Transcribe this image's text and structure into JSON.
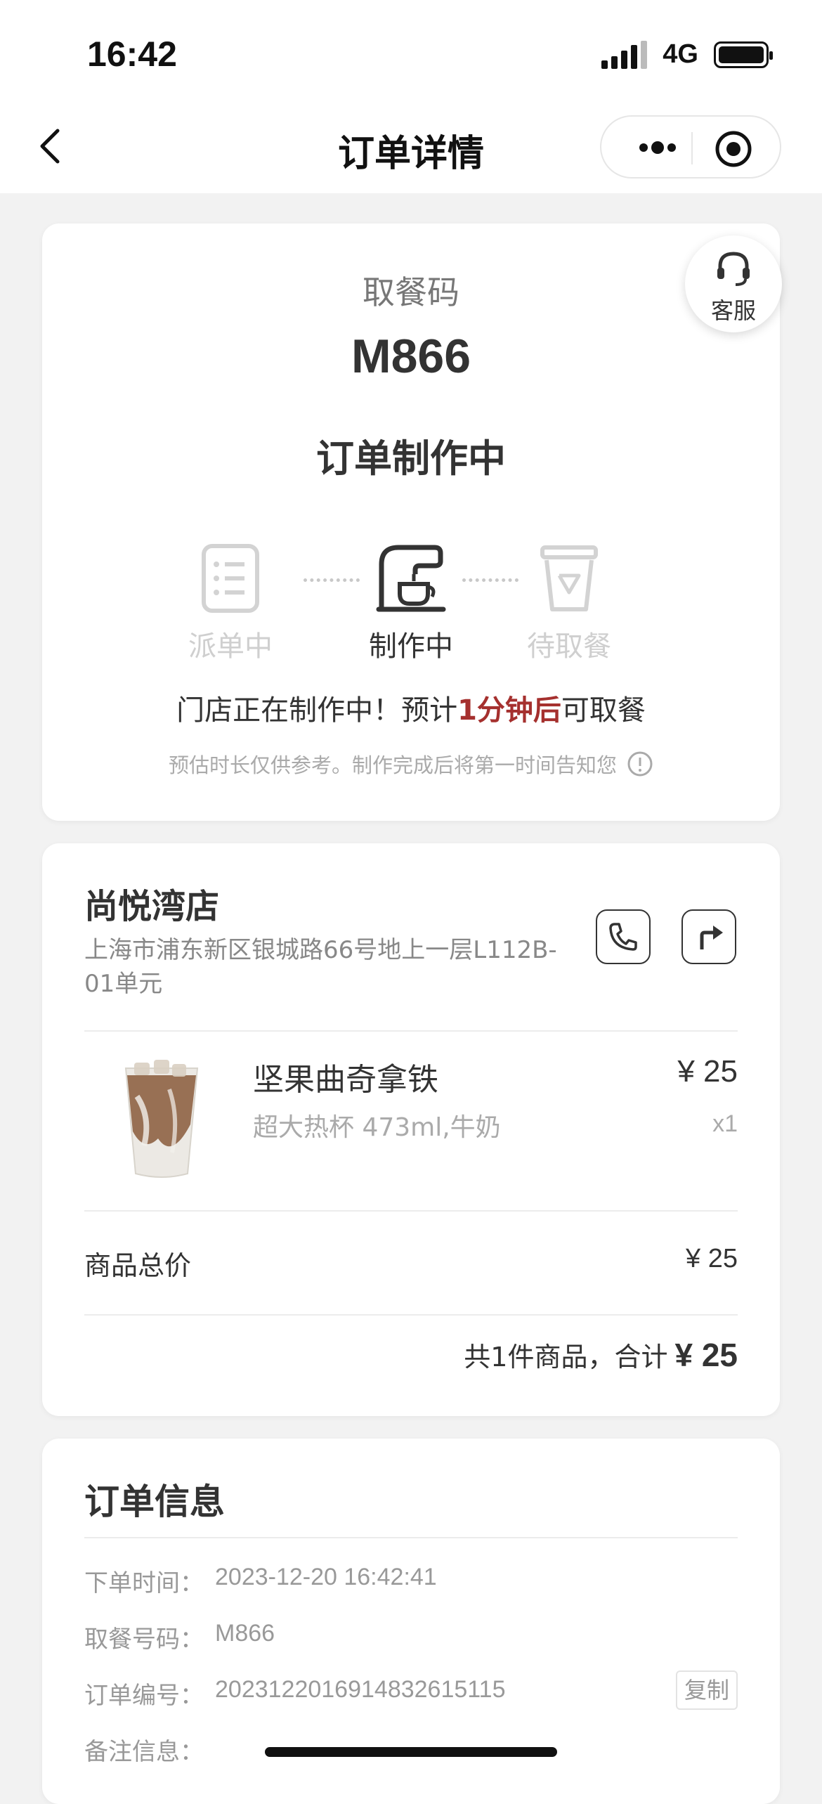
{
  "status_bar": {
    "time": "16:42",
    "network": "4G"
  },
  "nav": {
    "title": "订单详情"
  },
  "customer_service": {
    "label": "客服"
  },
  "pickup": {
    "label": "取餐码",
    "code": "M866",
    "status": "订单制作中",
    "steps": [
      {
        "label": "派单中",
        "active": false
      },
      {
        "label": "制作中",
        "active": true
      },
      {
        "label": "待取餐",
        "active": false
      }
    ],
    "message_prefix": "门店正在制作中！预计",
    "message_highlight": "1分钟后",
    "message_suffix": "可取餐",
    "note": "预估时长仅供参考。制作完成后将第一时间告知您",
    "highlight_color": "#a5302e"
  },
  "store": {
    "name": "尚悦湾店",
    "address": "上海市浦东新区银城路66号地上一层L112B-01单元"
  },
  "product": {
    "name": "坚果曲奇拿铁",
    "spec": "超大热杯 473ml,牛奶",
    "price": "¥ 25",
    "quantity": "x1"
  },
  "summary": {
    "subtotal_label": "商品总价",
    "subtotal_value": "¥ 25",
    "total_prefix": "共1件商品，合计",
    "total_value": "¥ 25"
  },
  "order_info": {
    "title": "订单信息",
    "rows": [
      {
        "key": "下单时间：",
        "value": "2023-12-20 16:42:41"
      },
      {
        "key": "取餐号码：",
        "value": "M866"
      },
      {
        "key": "订单编号：",
        "value": "20231220169148326151​15"
      },
      {
        "key": "备注信息：",
        "value": ""
      }
    ],
    "copy_label": "复制"
  }
}
